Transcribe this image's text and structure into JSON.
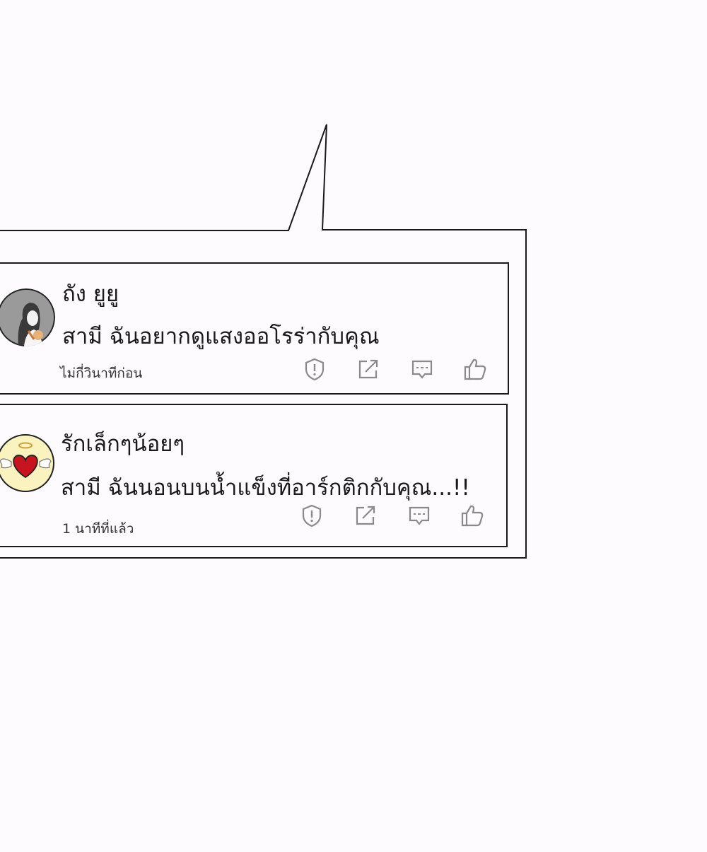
{
  "comments": [
    {
      "username": "ถัง ยูยู",
      "message": "สามี ฉันอยากดูแสงออโรร่ากับคุณ",
      "time": "ไม่กี่วินาทีก่อน",
      "avatar": "girl-portrait-avatar"
    },
    {
      "username": "รักเล็กๆน้อยๆ",
      "message": "สามี ฉันนอนบนน้ำแข็งที่อาร์กติกกับคุณ...!!",
      "time": "1 นาทีที่แล้ว",
      "avatar": "angel-heart-avatar"
    }
  ],
  "actions": [
    "report-icon",
    "share-icon",
    "comment-icon",
    "like-icon"
  ],
  "colors": {
    "outline": "#1a1a1a",
    "icon": "#8a8a8a",
    "heart": "#c8141e",
    "angel_bg": "#fbf3bf",
    "background": "#fdfbfd"
  }
}
